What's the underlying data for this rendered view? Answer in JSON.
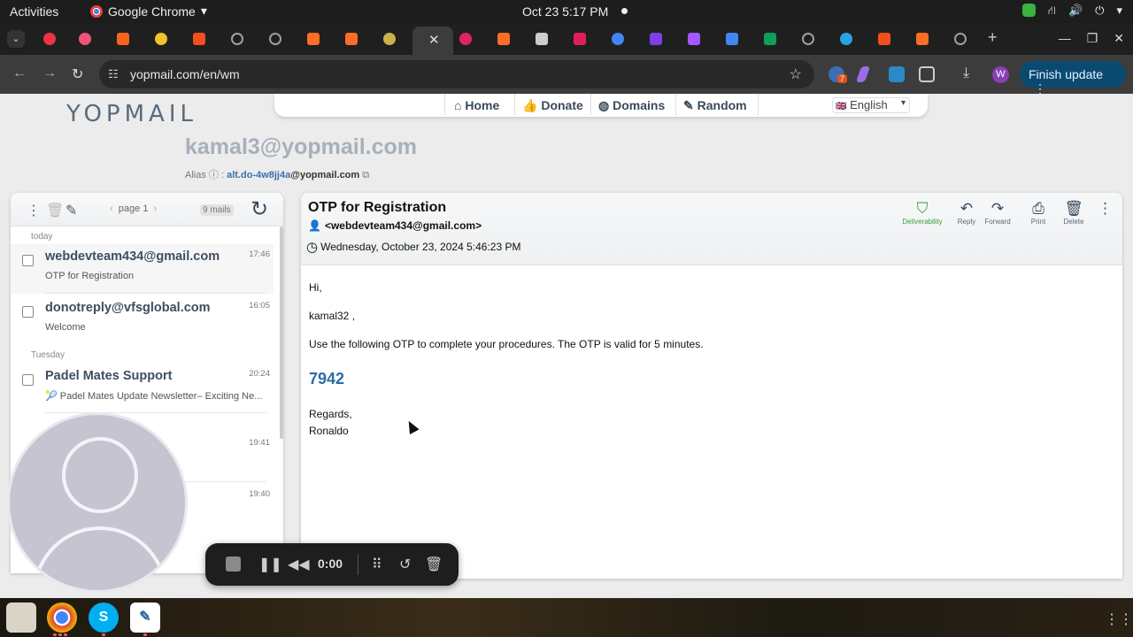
{
  "system": {
    "activities": "Activities",
    "app_name": "Google Chrome",
    "clock": "Oct 23  5:17 PM"
  },
  "browser": {
    "url": "yopmail.com/en/wm",
    "finish_update": "Finish update",
    "profile_initial": "W",
    "extension_badge": "7"
  },
  "site": {
    "logo": "YOPMAIL",
    "nav": [
      {
        "label": "Home",
        "icon": "home-icon"
      },
      {
        "label": "Donate",
        "icon": "thumbs-up-icon"
      },
      {
        "label": "Domains",
        "icon": "globe-icon"
      },
      {
        "label": "Random",
        "icon": "magic-wand-icon"
      }
    ],
    "language": "English",
    "inbox_address": "kamal3@yopmail.com",
    "alias_label": "Alias",
    "alias_prefix": "alt.do-4w8jj4a",
    "alias_domain": "@yopmail.com"
  },
  "inbox": {
    "page": "page 1",
    "count": "9 mails",
    "groups": [
      {
        "day": "today"
      },
      {
        "day": "Tuesday"
      }
    ],
    "mails": [
      {
        "from": "webdevteam434@gmail.com",
        "subject": "OTP for Registration",
        "time": "17:46"
      },
      {
        "from": "donotreply@vfsglobal.com",
        "subject": "Welcome",
        "time": "16:05"
      },
      {
        "from": "Padel Mates Support",
        "subject": "🎾 Padel Mates Update Newsletter– Exciting Ne...",
        "time": "20:24"
      },
      {
        "from": "",
        "subject": "",
        "time": "19:41"
      },
      {
        "from": "",
        "subject": "",
        "time": "19:40"
      }
    ]
  },
  "message": {
    "subject": "OTP for Registration",
    "from": "<webdevteam434@gmail.com>",
    "date": "Wednesday, October 23, 2024 5:46:23 PM",
    "actions": [
      {
        "label": "Deliverability",
        "icon": "shield-check-icon"
      },
      {
        "label": "Reply",
        "icon": "reply-icon"
      },
      {
        "label": "Forward",
        "icon": "forward-icon"
      },
      {
        "label": "Print",
        "icon": "print-icon"
      },
      {
        "label": "Delete",
        "icon": "trash-icon"
      }
    ],
    "body": {
      "greeting": "Hi,",
      "name": "kamal32 ,",
      "instruction": "Use the following OTP to complete your procedures. The OTP is valid for 5 minutes.",
      "otp": "7942",
      "closing": "Regards,",
      "signature": "Ronaldo"
    }
  },
  "recorder": {
    "timer": "0:00"
  },
  "colors": {
    "accent": "#2b6ca8",
    "chrome_update": "#0b4a70",
    "deliverability": "#2f9a3f"
  }
}
